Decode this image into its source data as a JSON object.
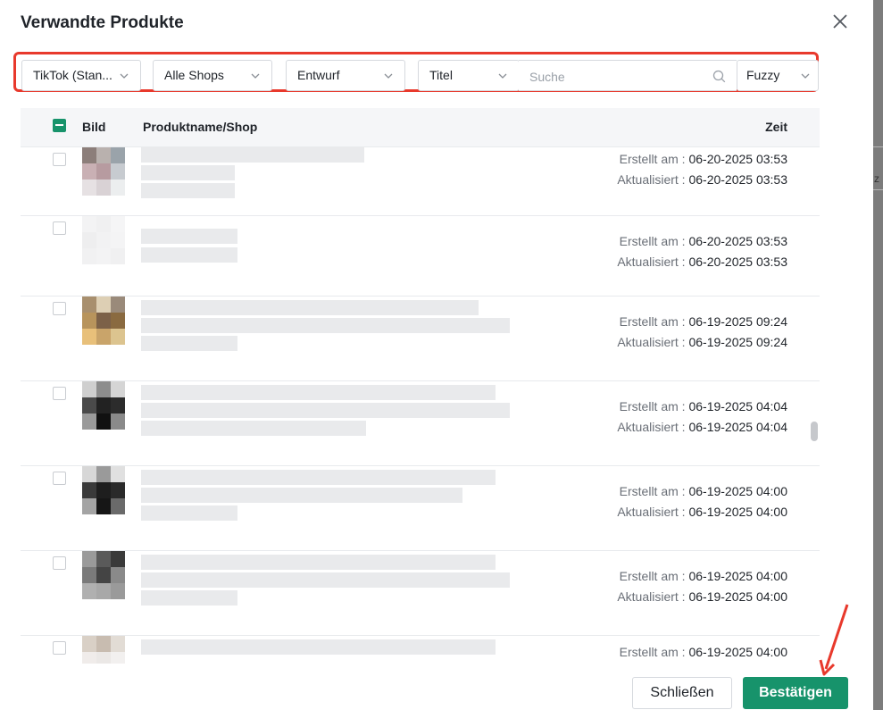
{
  "dialog": {
    "title": "Verwandte Produkte"
  },
  "filters": {
    "platform": "TikTok (Stan...",
    "shop": "Alle Shops",
    "status": "Entwurf",
    "field": "Titel",
    "search_placeholder": "Suche",
    "search_value": "",
    "match": "Fuzzy"
  },
  "table": {
    "columns": {
      "image": "Bild",
      "name": "Produktname/Shop",
      "time": "Zeit"
    },
    "created_label": "Erstellt am : ",
    "updated_label": "Aktualisiert : ",
    "rows": [
      {
        "created": "06-20-2025 03:53",
        "updated": "06-20-2025 03:53"
      },
      {
        "created": "06-20-2025 03:53",
        "updated": "06-20-2025 03:53"
      },
      {
        "created": "06-19-2025 09:24",
        "updated": "06-19-2025 09:24"
      },
      {
        "created": "06-19-2025 04:04",
        "updated": "06-19-2025 04:04"
      },
      {
        "created": "06-19-2025 04:00",
        "updated": "06-19-2025 04:00"
      },
      {
        "created": "06-19-2025 04:00",
        "updated": "06-19-2025 04:00"
      },
      {
        "created": "06-19-2025 04:00",
        "updated": ""
      }
    ]
  },
  "footer": {
    "close_label": "Schließen",
    "confirm_label": "Bestätigen"
  },
  "colors": {
    "accent": "#17936b",
    "highlight": "#e8392c"
  },
  "icons": {
    "close": "close-icon",
    "chevron": "chevron-down-icon",
    "search": "search-icon"
  }
}
